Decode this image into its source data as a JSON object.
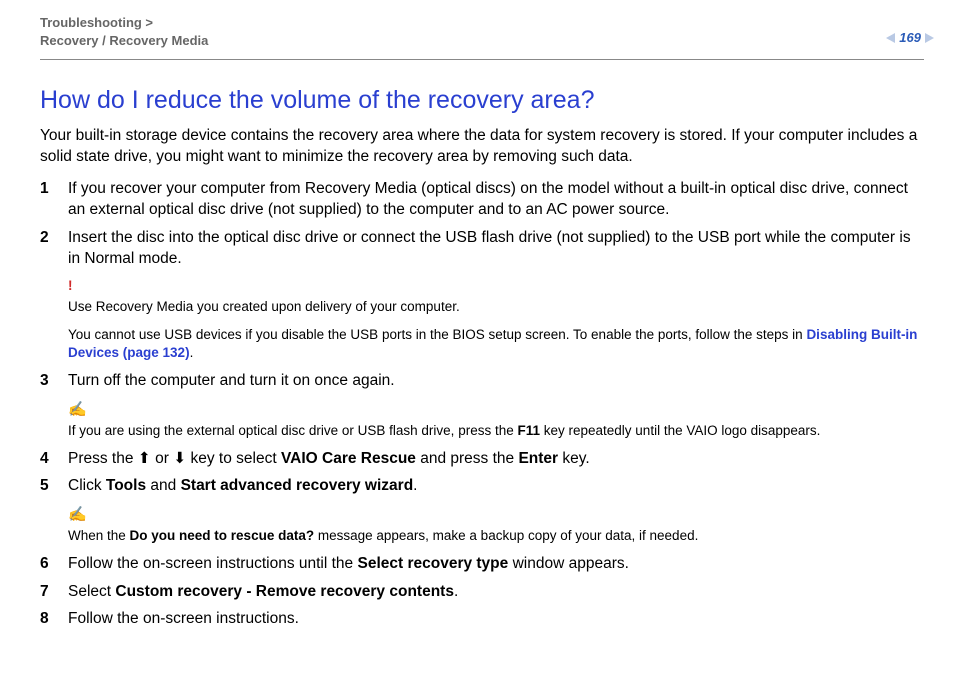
{
  "breadcrumb": {
    "line1": "Troubleshooting >",
    "line2": "Recovery / Recovery Media"
  },
  "page_number": "169",
  "title": "How do I reduce the volume of the recovery area?",
  "intro": "Your built-in storage device contains the recovery area where the data for system recovery is stored. If your computer includes a solid state drive, you might want to minimize the recovery area by removing such data.",
  "steps": {
    "s1": "If you recover your computer from Recovery Media (optical discs) on the model without a built-in optical disc drive, connect an external optical disc drive (not supplied) to the computer and to an AC power source.",
    "s2": "Insert the disc into the optical disc drive or connect the USB flash drive (not supplied) to the USB port while the computer is in Normal mode.",
    "note_alert": {
      "marker": "!",
      "line1": "Use Recovery Media you created upon delivery of your computer.",
      "line2_a": "You cannot use USB devices if you disable the USB ports in the BIOS setup screen. To enable the ports, follow the steps in ",
      "line2_link": "Disabling Built-in Devices (page 132)",
      "line2_b": "."
    },
    "s3": "Turn off the computer and turn it on once again.",
    "note_tip1": {
      "marker": "✍",
      "text_a": "If you are using the external optical disc drive or USB flash drive, press the ",
      "key": "F11",
      "text_b": " key repeatedly until the VAIO logo disappears."
    },
    "s4": {
      "a": "Press the ",
      "up": "⬆",
      "mid": " or ",
      "down": "⬇",
      "b": " key to select ",
      "bold1": "VAIO Care Rescue",
      "c": " and press the ",
      "bold2": "Enter",
      "d": " key."
    },
    "s5": {
      "a": "Click ",
      "b1": "Tools",
      "mid": " and ",
      "b2": "Start advanced recovery wizard",
      "end": "."
    },
    "note_tip2": {
      "marker": "✍",
      "a": "When the ",
      "b": "Do you need to rescue data?",
      "c": " message appears, make a backup copy of your data, if needed."
    },
    "s6": {
      "a": "Follow the on-screen instructions until the ",
      "b": "Select recovery type",
      "c": " window appears."
    },
    "s7": {
      "a": "Select ",
      "b": "Custom recovery - Remove recovery contents",
      "c": "."
    },
    "s8": "Follow the on-screen instructions."
  }
}
